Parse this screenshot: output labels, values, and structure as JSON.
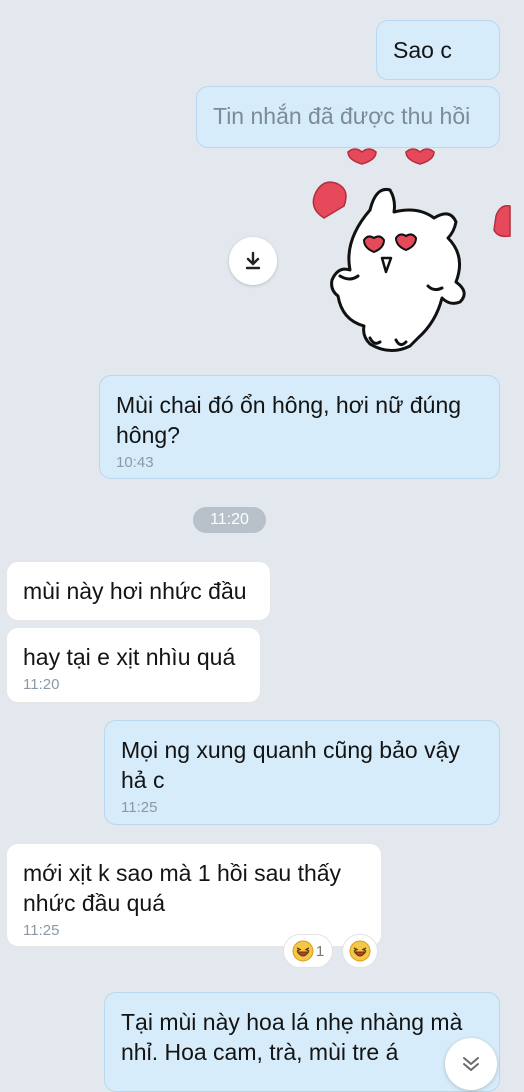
{
  "colors": {
    "background": "#e3e8ef",
    "my_bubble": "#d6ecfa",
    "their_bubble": "#ffffff",
    "time_separator": "#b8c0c9",
    "sticker_heart": "#e64a5a"
  },
  "messages": [
    {
      "sender": "me",
      "text": "Sao c"
    },
    {
      "sender": "me",
      "text": "Tin nhắn đã được thu hồi",
      "recalled": true
    },
    {
      "sender": "me",
      "type": "sticker",
      "icon": "cat-with-hearts-sticker"
    },
    {
      "sender": "me",
      "text": "Mùi chai đó ổn hông, hơi nữ đúng hông?",
      "time": "10:43"
    },
    {
      "sender": "them",
      "text": "mùi này hơi nhức đầu"
    },
    {
      "sender": "them",
      "text": "hay tại e xịt nhìu quá",
      "time": "11:20"
    },
    {
      "sender": "me",
      "text": "Mọi ng xung quanh cũng bảo vậy hả c",
      "time": "11:25"
    },
    {
      "sender": "them",
      "text": "mới xịt k sao mà 1 hồi sau thấy nhức đầu quá",
      "time": "11:25"
    },
    {
      "sender": "me",
      "text": "Tại mùi này hoa lá nhẹ nhàng mà nhỉ. Hoa cam, trà, mùi tre á"
    }
  ],
  "time_separator": "11:20",
  "reactions": {
    "emoji": "laughing-face-icon",
    "count": "1"
  },
  "download_icon": "download-icon",
  "scroll_icon": "chevron-double-down-icon"
}
